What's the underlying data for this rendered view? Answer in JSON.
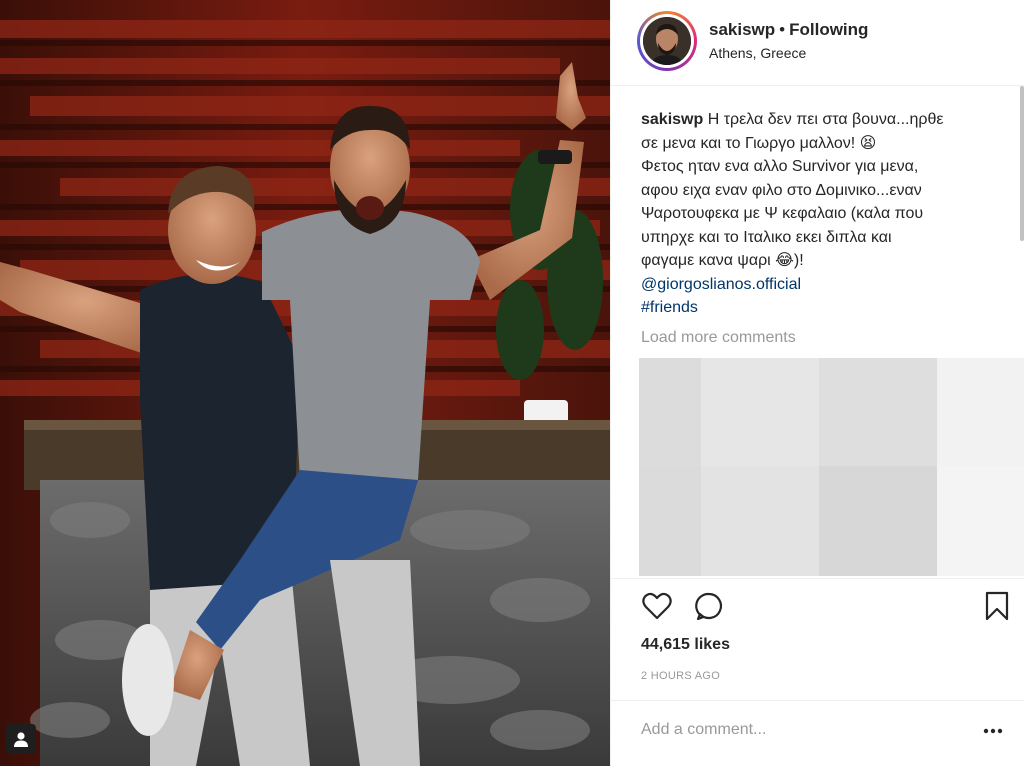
{
  "post": {
    "username": "sakiswp",
    "separator": "•",
    "follow_status": "Following",
    "location": "Athens, Greece",
    "caption": {
      "username": "sakiswp",
      "lines": [
        "Η τρελα δεν πει στα βουνα...ηρθε",
        "σε μενα και το Γιωργο μαλλον! 😫",
        "Φετος ηταν ενα αλλο Survivor για μενα,",
        "αφου ειχα εναν φιλο στο Δομινικο...εναν",
        "Ψαροτουφεκα με Ψ κεφαλαιο (καλα που",
        "υπηρχε και το Ιταλικο εκει διπλα και",
        "φαγαμε κανα ψαρι 😂)!"
      ],
      "mention": "@giorgoslianos.official",
      "hashtag": "#friends"
    },
    "load_more": "Load more comments",
    "likes": "44,615 likes",
    "timestamp": "2 HOURS AGO",
    "comment_placeholder": "Add a comment...",
    "more_label": "•••"
  },
  "icons": {
    "heart": "heart-icon",
    "comment": "comment-icon",
    "bookmark": "bookmark-icon",
    "tag": "user-tag-icon",
    "more": "more-options-icon"
  },
  "colors": {
    "link": "#003569",
    "muted": "#999999",
    "text": "#262626",
    "divider": "#efefef"
  }
}
